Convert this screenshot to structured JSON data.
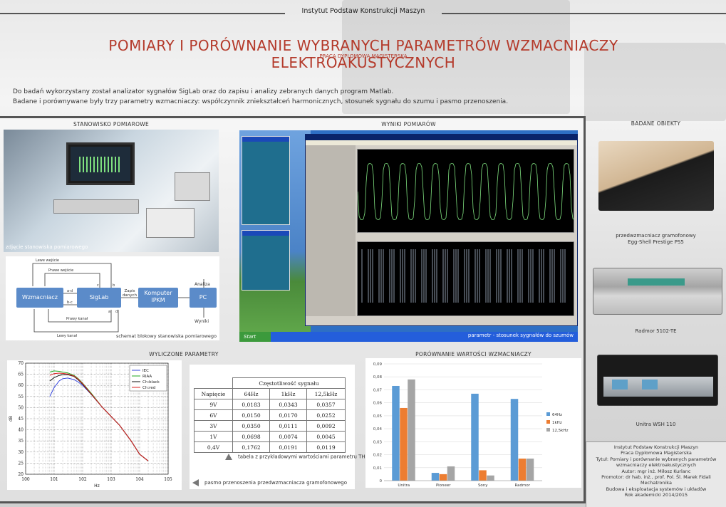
{
  "header": {
    "institute": "Instytut Podstaw Konstrukcji Maszyn"
  },
  "title": "POMIARY I PORÓWNANIE WYBRANYCH PARAMETRÓW WZMACNIACZY ELEKTROAKUSTYCZNYCH",
  "subtitle": "PRACA DYPLOMOWA MAGISTERSKA",
  "intro": [
    "Do badań wykorzystany został analizator sygnałów SigLab oraz do zapisu i analizy zebranych danych program Matlab.",
    "Badane i porównywane były trzy parametry wzmacniaczy: współczynnik zniekształceń harmonicznych, stosunek sygnału do szumu i pasmo przenoszenia."
  ],
  "sections": {
    "setup": "STANOWISKO POMIAROWE",
    "results": "WYNIKI POMIARÓW",
    "objects": "BADANE OBIEKTY",
    "computed": "WYLICZONE PARAMETRY",
    "comparison": "PORÓWNANIE WARTOŚCI WZMACNIACZY"
  },
  "photo_caption": "zdjęcie stanowiska pomiarowego",
  "block_diagram": {
    "caption": "schemat blokowy stanowiska pomiarowego",
    "amp": "Wzmacniacz",
    "siglab": "SigLab",
    "computer": "Komputer IPKM",
    "pc": "PC",
    "data_label": "Zapis danych",
    "analysis": "Analiza",
    "result": "Wyniki",
    "left_in": "Lewe wejście",
    "right_in": "Prawe wejście",
    "right_ch": "Prawy kanał",
    "left_ch": "Lewy kanał",
    "lbl_c": "c",
    "lbl_b": "b",
    "lbl_a": "a",
    "lbl_d": "d",
    "lbl_ad": "a-d",
    "lbl_bc": "b-c"
  },
  "screenshot": {
    "start": "Start",
    "status": "parametr - stosunek sygnałów do szumów"
  },
  "thd_table": {
    "group_header": "Częstotliwość sygnału",
    "col0": "Napięcie",
    "columns": [
      "64Hz",
      "1kHz",
      "12,5kHz"
    ],
    "rows": [
      {
        "v": "9V",
        "a": "0,0183",
        "b": "0,0343",
        "c": "0,0357"
      },
      {
        "v": "6V",
        "a": "0,0150",
        "b": "0,0170",
        "c": "0,0252"
      },
      {
        "v": "3V",
        "a": "0,0350",
        "b": "0,0111",
        "c": "0,0092"
      },
      {
        "v": "1V",
        "a": "0,0698",
        "b": "0,0074",
        "c": "0,0045"
      },
      {
        "v": "0,4V",
        "a": "0,1762",
        "b": "0,0191",
        "c": "0,0119"
      }
    ],
    "note_up": "tabela z przykładowymi wartościami parametru THD",
    "note_left": "pasmo przenoszenia przedwzmacniacza gramofonowego"
  },
  "objects": [
    {
      "name": "przedwzmacniacz gramofonowy",
      "model": "Egg-Shell Prestige PS5"
    },
    {
      "name": "",
      "model": "Radmor 5102-TE"
    },
    {
      "name": "",
      "model": "Unitra WSH 110"
    }
  ],
  "info": [
    "Instytut Podstaw Konstrukcji Maszyn",
    "Praca Dyplomowa Magisterska",
    "Tytuł: Pomiary i porównanie wybranych parametrów",
    "wzmacniaczy elektroakustycznych",
    "Autor: mgr inż. Miłosz Kurlanc",
    "Promotor: dr hab. inż., prof. Pol. Śl. Marek Fidali",
    "Mechatronika",
    "Budowa i eksploatacja systemów i układów",
    "Rok akademicki 2014/2015"
  ],
  "colors": {
    "title": "#b43a2b",
    "bar1": "#5b9bd5",
    "bar2": "#ed7d31",
    "bar3": "#a5a5a5"
  },
  "chart_data": [
    {
      "type": "line",
      "title": "",
      "xlabel": "Hz",
      "ylabel": "dB",
      "xscale": "log",
      "xlim": [
        1,
        100000
      ],
      "ylim": [
        20,
        70
      ],
      "xticks": [
        "10^0",
        "10^1",
        "10^2",
        "10^3",
        "10^4",
        "10^5"
      ],
      "yticks": [
        20,
        25,
        30,
        35,
        40,
        45,
        50,
        55,
        60,
        65,
        70
      ],
      "grid": true,
      "legend": "top-right",
      "series": [
        {
          "name": "IEC",
          "color": "#3344dd",
          "x": [
            7,
            10,
            15,
            20,
            30,
            50,
            70,
            100,
            200,
            500,
            1000,
            2000,
            5000,
            10000,
            20000
          ],
          "y": [
            55,
            59,
            62,
            63,
            63.3,
            62.6,
            61.5,
            60,
            56,
            50,
            46,
            42,
            35,
            29,
            26
          ]
        },
        {
          "name": "RIAA",
          "color": "#22aa22",
          "x": [
            7,
            10,
            15,
            20,
            30,
            50,
            70,
            100,
            200,
            500,
            1000,
            2000,
            5000,
            10000,
            20000
          ],
          "y": [
            66,
            66.5,
            66.3,
            66,
            65.6,
            64.5,
            63,
            61,
            56.5,
            50,
            46,
            42,
            35,
            29,
            26
          ]
        },
        {
          "name": "Ch:black",
          "color": "#111111",
          "x": [
            7,
            10,
            15,
            20,
            30,
            50,
            70,
            100,
            200,
            500,
            1000,
            2000,
            5000,
            10000,
            20000
          ],
          "y": [
            62,
            63.5,
            64.5,
            64.8,
            64.8,
            64,
            62.5,
            60.5,
            56,
            50,
            46,
            42,
            35,
            29,
            26
          ]
        },
        {
          "name": "Ch:red",
          "color": "#dd2222",
          "x": [
            7,
            10,
            15,
            20,
            30,
            50,
            70,
            100,
            200,
            500,
            1000,
            2000,
            5000,
            10000,
            20000
          ],
          "y": [
            64.5,
            65.3,
            65.5,
            65.4,
            65.1,
            64.2,
            62.8,
            60.8,
            56.2,
            50,
            46,
            42,
            35,
            29,
            26
          ]
        }
      ]
    },
    {
      "type": "bar",
      "title": "",
      "categories": [
        "Unitra",
        "Pioneer",
        "Sony",
        "Radmor"
      ],
      "ylim": [
        0,
        0.09
      ],
      "yticks": [
        "0",
        "0,01",
        "0,02",
        "0,03",
        "0,04",
        "0,05",
        "0,06",
        "0,07",
        "0,08",
        "0,09"
      ],
      "legend": "right",
      "series": [
        {
          "name": "64Hz",
          "color": "#5b9bd5",
          "values": [
            0.073,
            0.006,
            0.067,
            0.063
          ]
        },
        {
          "name": "1kHz",
          "color": "#ed7d31",
          "values": [
            0.056,
            0.005,
            0.008,
            0.017
          ]
        },
        {
          "name": "12,5kHz",
          "color": "#a5a5a5",
          "values": [
            0.078,
            0.011,
            0.004,
            0.017
          ]
        }
      ]
    }
  ]
}
